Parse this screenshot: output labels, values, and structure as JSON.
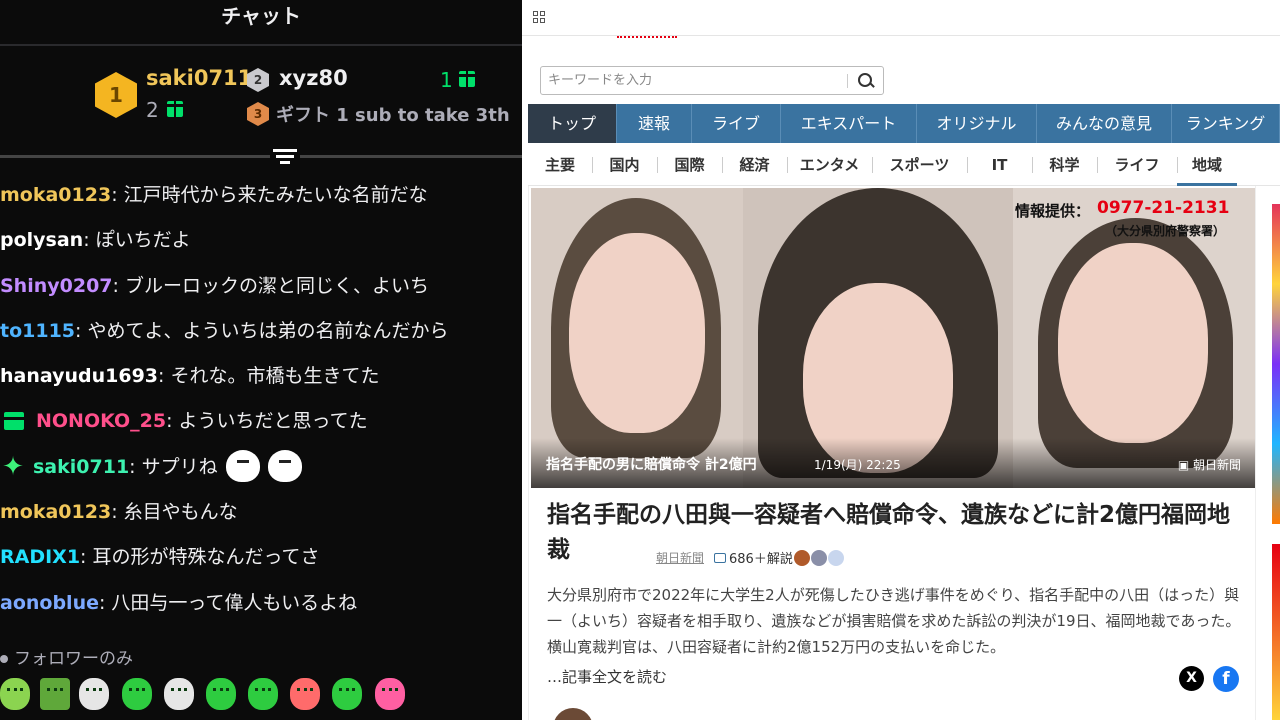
{
  "chat": {
    "title": "チャット",
    "leaderboard": {
      "first": {
        "rank": "1",
        "name": "saki0711",
        "count": "2"
      },
      "second": {
        "rank": "2",
        "name": "xyz80",
        "count": "1"
      },
      "third": {
        "rank": "3",
        "text": "ギフト 1 sub to take 3th"
      }
    },
    "messages": [
      {
        "user": "moka0123",
        "color": "#f0c65a",
        "text": ": 江戸時代から来たみたいな名前だな"
      },
      {
        "user": "polysan",
        "color": "#ffffff",
        "text": ": ぽいちだよ"
      },
      {
        "user": "Shiny0207",
        "color": "#c28cff",
        "text": ": ブルーロックの潔と同じく、よいち"
      },
      {
        "user": "to1115",
        "color": "#4fb4ff",
        "text": ": やめてよ、よういちは弟の名前なんだから"
      },
      {
        "user": "hanayudu1693",
        "color": "#ffffff",
        "text": ": それな。市橋も生きてた"
      },
      {
        "user": "NONOKO_25",
        "color": "#ff4f8b",
        "text": ": よういちだと思ってた",
        "badge": "gift"
      },
      {
        "user": "saki0711",
        "color": "#3df2b0",
        "text": ": サプリね",
        "badge": "star",
        "emotes": 2
      },
      {
        "user": "moka0123",
        "color": "#f0c65a",
        "text": ": 糸目やもんな"
      },
      {
        "user": "RADIX1",
        "color": "#22e1ff",
        "text": ": 耳の形が特殊なんだってさ"
      },
      {
        "user": "aonoblue",
        "color": "#7da9ff",
        "text": ": 八田与一って偉人もいるよね"
      }
    ],
    "follower_note": "フォロワーのみ"
  },
  "browser": {
    "search": {
      "placeholder": "キーワードを入力",
      "value": ""
    },
    "global_nav": [
      "トップ",
      "速報",
      "ライブ",
      "エキスパート",
      "オリジナル",
      "みんなの意見",
      "ランキング"
    ],
    "sub_nav": [
      "主要",
      "国内",
      "国際",
      "経済",
      "エンタメ",
      "スポーツ",
      "IT",
      "科学",
      "ライフ",
      "地域"
    ],
    "hero": {
      "headline": "指名手配の男に賠償命令 計2億円",
      "date": "1/19(月) 22:25",
      "credit": "朝日新聞",
      "tel_label": "情報提供：",
      "tel": "0977-21-2131",
      "police": "（大分県別府警察署）"
    },
    "article": {
      "title": "指名手配の八田與一容疑者へ賠償命令、遺族などに計2億円福岡地裁",
      "source": "朝日新聞",
      "comments": "686＋解説",
      "summary": "大分県別府市で2022年に大学生2人が死傷したひき逃げ事件をめぐり、指名手配中の八田（はった）與一（よいち）容疑者を相手取り、遺族などが損害賠償を求めた訴訟の判決が19日、福岡地裁であった。横山寛裁判官は、八田容疑者に計約2億152万円の支払いを命じた。",
      "read_more": "…記事全文を読む",
      "share_x": "X",
      "share_fb": "f"
    }
  }
}
